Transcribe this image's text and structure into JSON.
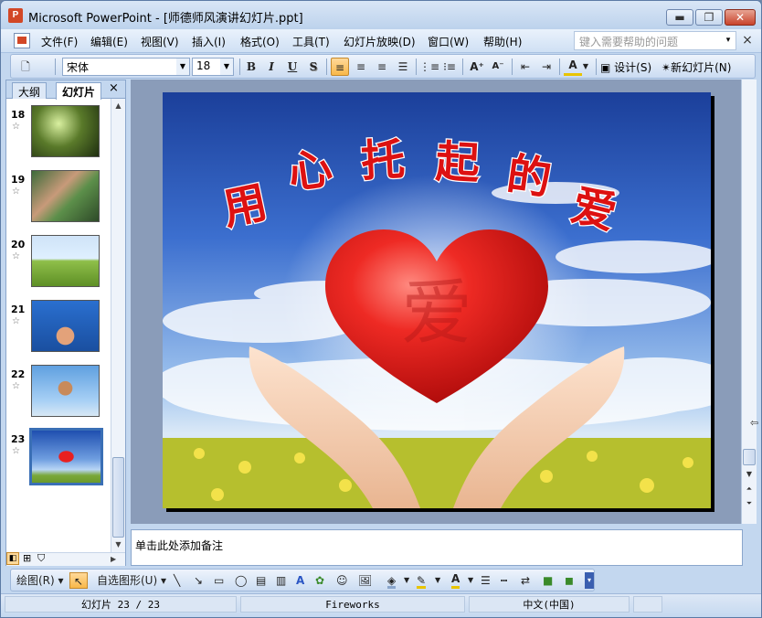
{
  "window": {
    "title": "Microsoft PowerPoint - [师德师风演讲幻灯片.ppt]",
    "app_icon": "P",
    "min_glyph": "▬",
    "max_glyph": "❐",
    "close_glyph": "✕"
  },
  "menubar": {
    "items": [
      "文件(F)",
      "编辑(E)",
      "视图(V)",
      "插入(I)",
      "格式(O)",
      "工具(T)",
      "幻灯片放映(D)",
      "窗口(W)",
      "帮助(H)"
    ],
    "help_placeholder": "键入需要帮助的问题",
    "help_arrow": "▾",
    "close_glyph": "×"
  },
  "toolbar": {
    "font_name": "宋体",
    "font_size": "18",
    "bold": "B",
    "italic": "I",
    "underline": "U",
    "shadow": "S",
    "design_label": "设计(S)",
    "new_slide_label": "新幻灯片(N)"
  },
  "left_pane": {
    "tab_outline": "大纲",
    "tab_slides": "幻灯片",
    "close_glyph": "×",
    "thumbnails": [
      {
        "number": "18",
        "star": "☆"
      },
      {
        "number": "19",
        "star": "☆"
      },
      {
        "number": "20",
        "star": "☆"
      },
      {
        "number": "21",
        "star": "☆"
      },
      {
        "number": "22",
        "star": "☆"
      },
      {
        "number": "23",
        "star": "☆",
        "selected": true
      }
    ]
  },
  "slide": {
    "title_chars": [
      "用",
      "心",
      "托",
      "起",
      "的",
      "爱"
    ],
    "heart_char": "爱"
  },
  "notes": {
    "placeholder": "单击此处添加备注"
  },
  "drawbar": {
    "draw_label": "绘图(R)",
    "autoshape_label": "自选图形(U)"
  },
  "statusbar": {
    "slide_info": "幻灯片 23 / 23",
    "design_name": "Fireworks",
    "language": "中文(中国)"
  }
}
